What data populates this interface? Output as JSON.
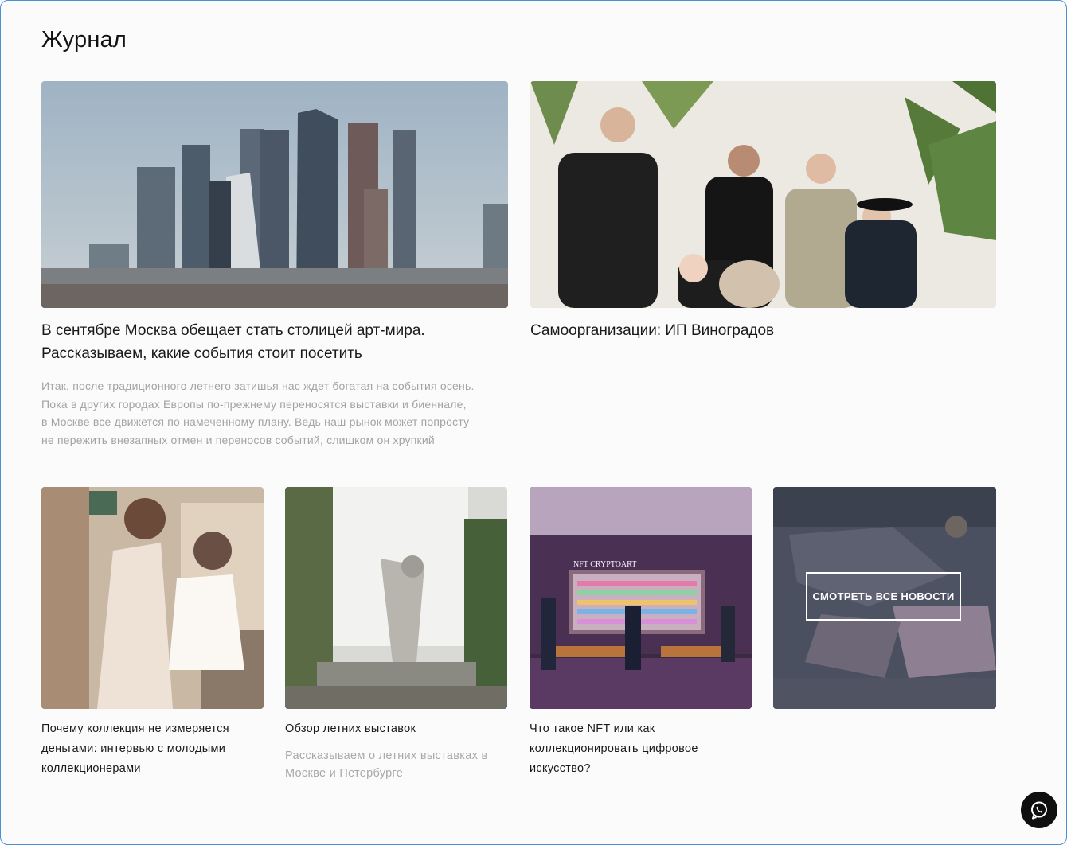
{
  "page": {
    "title": "Журнал"
  },
  "featured": [
    {
      "title_line1": "В сентябре Москва обещает стать столицей арт-мира.",
      "title_line2": "Рассказываем, какие события стоит посетить",
      "desc_lines": [
        "Итак, после традиционного летнего затишья нас ждет богатая на события осень.",
        "Пока в других городах Европы по-прежнему переносятся выставки и биеннале,",
        "в Москве все движется по намеченному плану. Ведь наш рынок может попросту",
        "не пережить внезапных отмен и переносов событий, слишком он хрупкий"
      ],
      "image": "moscow-city-skyline"
    },
    {
      "title_line1": "Самоорганизации: ИП Виноградов",
      "image": "group-photo-with-dog"
    }
  ],
  "articles": [
    {
      "title_lines": [
        "Почему коллекция не измеряется",
        "деньгами: интервью с молодыми",
        "коллекционерами"
      ],
      "image": "couple-on-street"
    },
    {
      "title_lines": [
        "Обзор летних выставок"
      ],
      "desc_lines": [
        "Рассказываем о летних выставках в",
        "Москве и Петербурге"
      ],
      "image": "exhibition-figure-sculpture"
    },
    {
      "title_lines": [
        "Что такое NFT или как",
        "коллекционировать цифровое",
        "искусство?"
      ],
      "image": "nft-cryptoart-gallery",
      "image_caption": "NFT CRYPTOART"
    }
  ],
  "all_news": {
    "label": "СМОТРЕТЬ ВСЕ НОВОСТИ"
  },
  "colors": {
    "accent_border": "#4a90d9",
    "text_primary": "#1a1a1a",
    "text_muted": "#a3a3a3",
    "whatsapp_bg": "#0f0f0f"
  },
  "icons": {
    "whatsapp": "whatsapp-icon"
  }
}
